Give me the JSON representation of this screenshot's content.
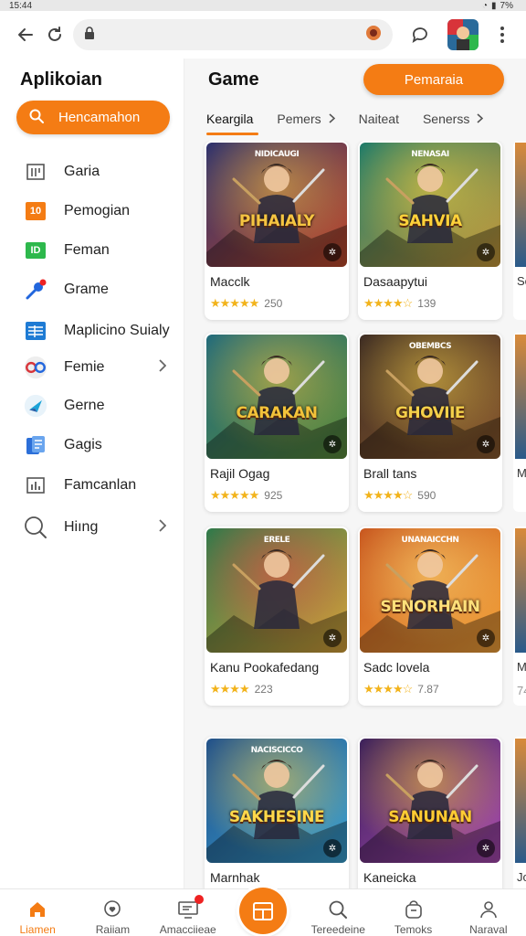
{
  "status": {
    "time": "15:44",
    "battery": "7%"
  },
  "browser": {
    "url": ""
  },
  "sidebar": {
    "title": "Aplikoian",
    "search_label": "Hencamahon",
    "items": [
      {
        "label": "Garia",
        "icon": "grid-icon",
        "color": "#555555"
      },
      {
        "label": "Pemogian",
        "icon": "number-badge-icon",
        "badge": "10",
        "color": "#f47c14"
      },
      {
        "label": "Feman",
        "icon": "id-badge-icon",
        "badge": "ID",
        "color": "#2db84c"
      },
      {
        "label": "Grame",
        "icon": "pin-icon",
        "color": "#2266dd"
      },
      {
        "label": "Maplicino Suialy",
        "icon": "table-icon",
        "color": "#1e7bd4"
      },
      {
        "label": "Femie",
        "icon": "circles-icon",
        "color": "#d8343a",
        "chevron": true
      },
      {
        "label": "Gerne",
        "icon": "compass-icon",
        "color": "#1aa3d8"
      },
      {
        "label": "Gagis",
        "icon": "docs-icon",
        "color": "#2c6fd8"
      },
      {
        "label": "Famcanlan",
        "icon": "chart-icon",
        "color": "#555555"
      },
      {
        "label": "Hiıng",
        "icon": "search-circle-icon",
        "color": "#555555",
        "chevron": true
      }
    ]
  },
  "main": {
    "title": "Game",
    "button_label": "Pemaraia",
    "tabs": [
      {
        "label": "Keargila",
        "active": true
      },
      {
        "label": "Pemers",
        "chevron": true
      },
      {
        "label": "Naiteat"
      },
      {
        "label": "Senerss",
        "chevron": true
      }
    ],
    "cards": [
      {
        "name": "Macclk",
        "stars": "★★★★★",
        "rating": "250",
        "art_text": "PIHAIALY",
        "art_sub": "NIDICAUGI",
        "bg1": "#2a2f6e",
        "bg2": "#c04a2a",
        "accent": "#f5c542"
      },
      {
        "name": "Dasaapytui",
        "stars": "★★★★☆",
        "rating": "139",
        "art_text": "SAHVIA",
        "art_sub": "NENASAI",
        "bg1": "#1c7a6a",
        "bg2": "#c99a3a",
        "accent": "#ffd23a"
      },
      {
        "name": "Rajil Ogag",
        "stars": "★★★★★",
        "rating": "925",
        "art_text": "CARAKAN",
        "art_sub": "",
        "bg1": "#1f6a7c",
        "bg2": "#5a8a3a",
        "accent": "#f2c23a"
      },
      {
        "name": "Brall tans",
        "stars": "★★★★☆",
        "rating": "590",
        "art_text": "GHOVIIE",
        "art_sub": "OBEMBCS",
        "bg1": "#3b2a22",
        "bg2": "#8a5a2e",
        "accent": "#f4d04a"
      },
      {
        "name": "Kanu Pookafedang",
        "stars": "★★★★",
        "rating": "223",
        "art_text": "",
        "art_sub": "ERELE",
        "bg1": "#2c7a4a",
        "bg2": "#d8a23a",
        "accent": "#e44"
      },
      {
        "name": "Sadc lovela",
        "stars": "★★★★☆",
        "rating": "7.87",
        "art_text": "SENORHAIN",
        "art_sub": "UNANAICCHN",
        "bg1": "#c8561e",
        "bg2": "#f2a23a",
        "accent": "#ffe07a"
      },
      {
        "name": "Marnhak",
        "stars": "",
        "rating": "",
        "art_text": "SAKHESINE",
        "art_sub": "NACISCICCO",
        "bg1": "#1f4f8a",
        "bg2": "#3aa0d0",
        "accent": "#ffd84a"
      },
      {
        "name": "Kaneicka",
        "stars": "",
        "rating": "",
        "art_text": "SANUNAN",
        "art_sub": "",
        "bg1": "#3a1f5a",
        "bg2": "#a84ab0",
        "accent": "#ffcc33"
      }
    ],
    "peek_labels": [
      "Sc",
      "M",
      "M",
      "74",
      "Jo"
    ]
  },
  "bottom_nav": [
    {
      "label": "Liamen",
      "icon": "home-icon",
      "active": true
    },
    {
      "label": "Raiiam",
      "icon": "heart-chat-icon"
    },
    {
      "label": "Amacciieae",
      "icon": "monitor-icon",
      "badge": true
    },
    {
      "label": "",
      "icon": "apps-icon",
      "center": true
    },
    {
      "label": "Tereedeine",
      "icon": "search-icon"
    },
    {
      "label": "Temoks",
      "icon": "bag-icon"
    },
    {
      "label": "Naraval",
      "icon": "person-icon"
    }
  ]
}
